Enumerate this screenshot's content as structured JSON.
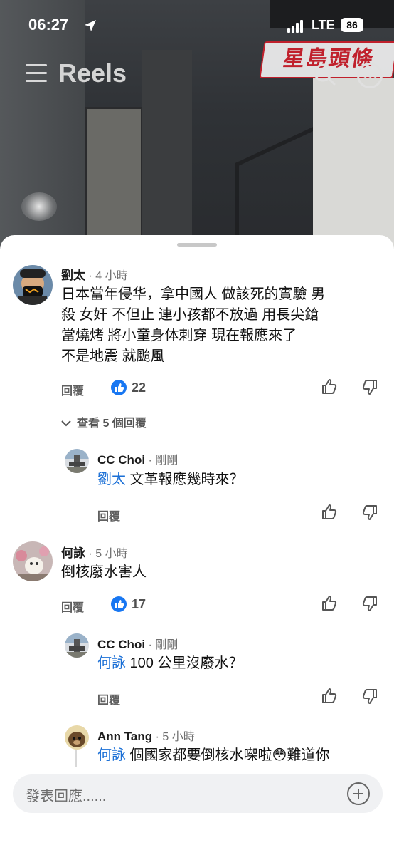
{
  "status": {
    "time": "06:27",
    "network": "LTE",
    "battery": "86"
  },
  "header": {
    "title": "Reels",
    "logo_text": "星島頭條"
  },
  "comments": [
    {
      "author": "劉太",
      "time": "· 4 小時",
      "lines": [
        "日本當年侵华，拿中國人 做該死的實驗 男",
        "殺 女奸 不但止 連小孩都不放過 用長尖鎗",
        "當燒烤 將小童身体刺穿 現在報應來了",
        "不是地震 就颱風"
      ],
      "reply_label": "回覆",
      "like_count": "22",
      "view_replies": "查看 5 個回覆"
    },
    {
      "author": "CC Choi",
      "time": "· 剛剛",
      "mention": "劉太",
      "text": " 文革報應幾時來？",
      "reply_label": "回覆"
    },
    {
      "author": "何詠",
      "time": "· 5 小時",
      "text": "倒核廢水害人",
      "reply_label": "回覆",
      "like_count": "17"
    },
    {
      "author": "CC Choi",
      "time": "· 剛剛",
      "mention": "何詠",
      "text": " 100 公里沒廢水？",
      "reply_label": "回覆"
    },
    {
      "author": "Ann Tang",
      "time": "· 5 小時",
      "mention": "何詠",
      "text": " 個國家都要倒核水㗎啦😳難道你"
    }
  ],
  "composer": {
    "placeholder": "發表回應......"
  },
  "colors": {
    "accent": "#1877f2",
    "mention": "#1a6fd6"
  }
}
